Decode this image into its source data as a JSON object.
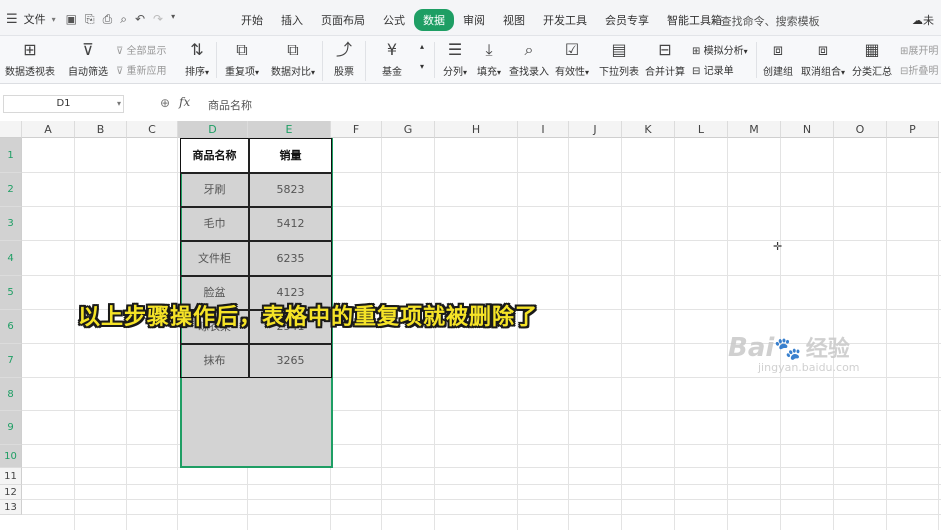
{
  "menubar": {
    "file_label": "文件",
    "tabs": [
      {
        "label": "开始",
        "active": false
      },
      {
        "label": "插入",
        "active": false
      },
      {
        "label": "页面布局",
        "active": false
      },
      {
        "label": "公式",
        "active": false
      },
      {
        "label": "数据",
        "active": true
      },
      {
        "label": "审阅",
        "active": false
      },
      {
        "label": "视图",
        "active": false
      },
      {
        "label": "开发工具",
        "active": false
      },
      {
        "label": "会员专享",
        "active": false
      },
      {
        "label": "智能工具箱",
        "active": false
      }
    ],
    "search_label": "查找命令、搜索模板",
    "cloud_label": "未"
  },
  "ribbon": {
    "pivot_table": "数据透视表",
    "auto_filter": "自动筛选",
    "show_all": "全部显示",
    "reapply": "重新应用",
    "sort": "排序",
    "duplicates": "重复项",
    "data_compare": "数据对比",
    "stock": "股票",
    "fund": "基金",
    "split_column": "分列",
    "fill": "填充",
    "find_entry": "查找录入",
    "validity": "有效性",
    "dropdown_list": "下拉列表",
    "merge_calc": "合并计算",
    "simulation": "模拟分析",
    "record_form": "记录单",
    "create_group": "创建组",
    "ungroup": "取消组合",
    "subtotal": "分类汇总",
    "expand": "展开明",
    "collapse": "折叠明"
  },
  "formula_bar": {
    "cell_ref": "D1",
    "fx_label": "fx",
    "formula": "商品名称"
  },
  "sheet": {
    "columns": [
      "A",
      "B",
      "C",
      "D",
      "E",
      "F",
      "G",
      "H",
      "I",
      "J",
      "K",
      "L",
      "M",
      "N",
      "O",
      "P"
    ],
    "rows": [
      "1",
      "2",
      "3",
      "4",
      "5",
      "6",
      "7",
      "8",
      "9",
      "10",
      "11",
      "12",
      "13"
    ],
    "table_headers": [
      "商品名称",
      "销量"
    ],
    "table_rows": [
      [
        "牙刷",
        "5823"
      ],
      [
        "毛巾",
        "5412"
      ],
      [
        "文件柜",
        "6235"
      ],
      [
        "脸盆",
        "4123"
      ],
      [
        "晾衣架",
        "2541"
      ],
      [
        "抹布",
        "3265"
      ]
    ]
  },
  "caption": "以上步骤操作后，表格中的重复项就被删除了",
  "watermark": {
    "logo": "Bai",
    "brand": "经验",
    "url": "jingyan.baidu.com"
  },
  "colors": {
    "accent": "#1e9e64",
    "caption": "#f5e327",
    "selection_fill": "#d3d3d3"
  }
}
